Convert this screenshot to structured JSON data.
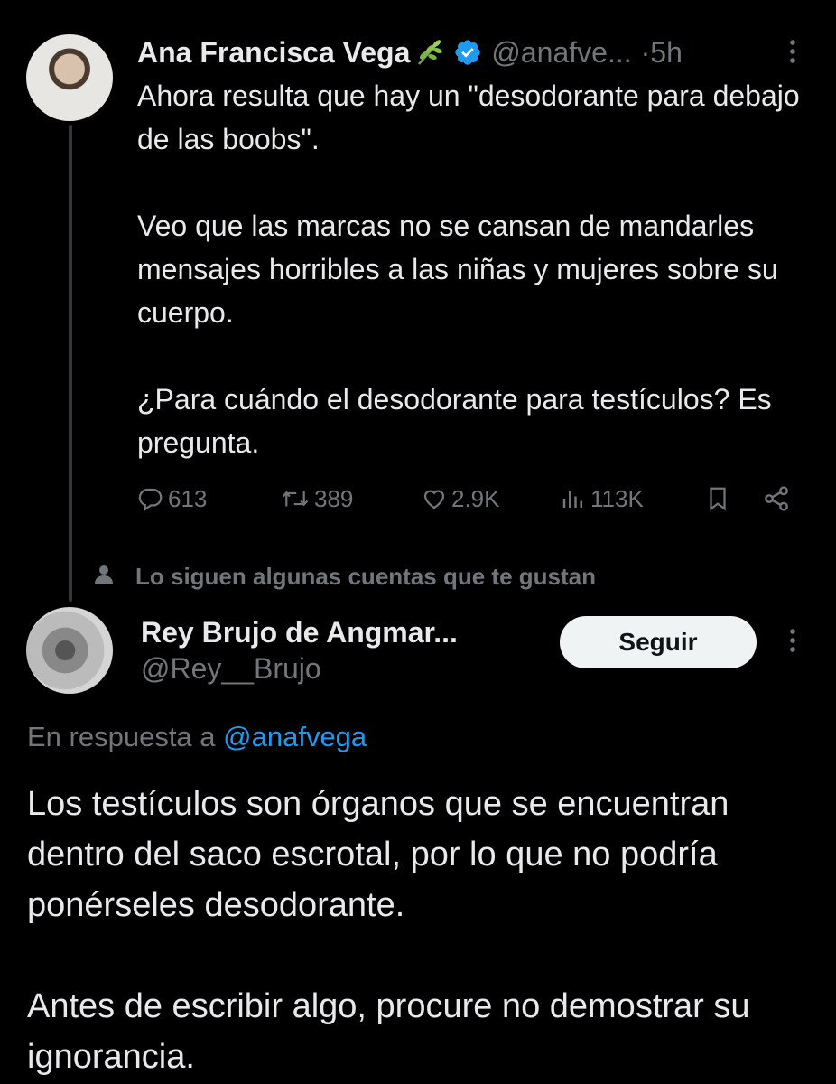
{
  "tweet1": {
    "author_name": "Ana Francisca Vega",
    "author_handle": "@anafve...",
    "dot": "·",
    "time": "5h",
    "paragraphs": [
      "Ahora resulta que hay un \"desodorante para debajo de las boobs\".",
      "Veo que las marcas no se cansan de mandarles mensajes horribles a las niñas y mujeres sobre su cuerpo.",
      "¿Para cuándo el desodorante para testículos? Es pregunta."
    ],
    "stats": {
      "replies": "613",
      "retweets": "389",
      "likes": "2.9K",
      "views": "113K"
    },
    "icons": {
      "leaf": "leaf-icon",
      "verified": "verified-icon",
      "more": "more-icon",
      "reply": "reply-icon",
      "retweet": "retweet-icon",
      "like": "heart-icon",
      "views": "views-icon",
      "bookmark": "bookmark-icon",
      "share": "share-icon"
    }
  },
  "social_context": {
    "text": "Lo siguen algunas cuentas que te gustan",
    "icon": "person-icon"
  },
  "tweet2": {
    "author_name": "Rey Brujo de Angmar...",
    "author_handle": "@Rey__Brujo",
    "follow_label": "Seguir",
    "reply_prefix": "En respuesta a ",
    "reply_mention": "@anafvega",
    "paragraphs": [
      "Los testículos son órganos que se encuentran dentro del saco escrotal, por lo que no podría ponérseles desodorante.",
      "Antes de escribir algo, procure no demostrar su ignorancia."
    ]
  },
  "colors": {
    "background": "#000000",
    "text": "#e7e9ea",
    "secondary": "#71767b",
    "link": "#1d9bf0",
    "verified": "#1d9bf0",
    "follow_bg": "#eff3f4"
  }
}
